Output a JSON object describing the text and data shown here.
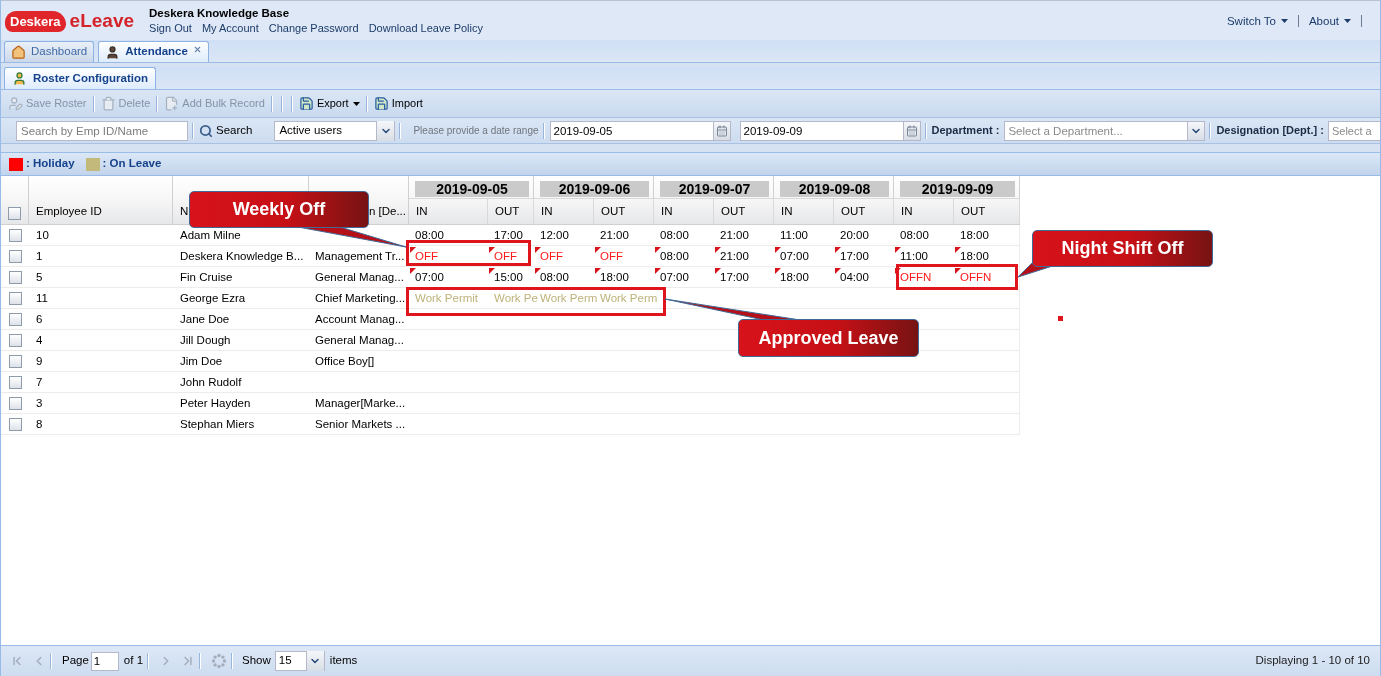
{
  "header": {
    "logo": {
      "brand": "Deskera",
      "product": "eLeave"
    },
    "title": "Deskera Knowledge Base",
    "links": [
      "Sign Out",
      "My Account",
      "Change Password",
      "Download Leave Policy"
    ],
    "menus": [
      "Switch To",
      "About"
    ]
  },
  "main_tabs": [
    {
      "label": "Dashboard",
      "selected": false,
      "closable": false
    },
    {
      "label": "Attendance",
      "selected": true,
      "closable": true
    }
  ],
  "sub_tabs": [
    {
      "label": "Roster Configuration",
      "selected": true
    }
  ],
  "toolbar": [
    {
      "label": "Save Roster",
      "disabled": true,
      "menu": false
    },
    {
      "label": "Delete",
      "disabled": true,
      "menu": false
    },
    {
      "label": "Add Bulk Record",
      "disabled": true,
      "menu": false
    },
    {
      "label": "Export",
      "disabled": false,
      "menu": true
    },
    {
      "label": "Import",
      "disabled": false,
      "menu": false
    }
  ],
  "filters": {
    "search": {
      "placeholder": "Search by Emp ID/Name"
    },
    "search_button": "Search",
    "status": {
      "value": "Active users"
    },
    "date_hint": "Please provide a date range",
    "date_from": {
      "value": "2019-09-05"
    },
    "date_to": {
      "value": "2019-09-09"
    },
    "department": {
      "label": "Department :",
      "placeholder": "Select a Department..."
    },
    "designation": {
      "label": "Designation [Dept.] :",
      "placeholder": "Select a"
    }
  },
  "legend": [
    {
      "label": ": Holiday",
      "color": "#ff0000"
    },
    {
      "label": ": On Leave",
      "color": "#c3b97a"
    }
  ],
  "grid": {
    "all_selected": false,
    "columns": [
      "Employee ID",
      "N",
      "n [De..."
    ],
    "dates": [
      {
        "date": "2019-09-05",
        "in": "IN",
        "out": "OUT"
      },
      {
        "date": "2019-09-06",
        "in": "IN",
        "out": "OUT"
      },
      {
        "date": "2019-09-07",
        "in": "IN",
        "out": "OUT"
      },
      {
        "date": "2019-09-08",
        "in": "IN",
        "out": "OUT"
      },
      {
        "date": "2019-09-09",
        "in": "IN",
        "out": "OUT"
      }
    ],
    "rows": [
      {
        "selected": false,
        "edited": false,
        "id": "10",
        "name": "Adam Milne",
        "shifts": [
          {
            "text": "08:00",
            "kind": "time"
          },
          {
            "text": "17:00",
            "kind": "time"
          },
          {
            "text": "12:00",
            "kind": "time"
          },
          {
            "text": "21:00",
            "kind": "time"
          },
          {
            "text": "08:00",
            "kind": "time"
          },
          {
            "text": "21:00",
            "kind": "time"
          },
          {
            "text": "11:00",
            "kind": "time"
          },
          {
            "text": "20:00",
            "kind": "time"
          },
          {
            "text": "08:00",
            "kind": "time"
          },
          {
            "text": "18:00",
            "kind": "time"
          }
        ]
      },
      {
        "selected": false,
        "edited": true,
        "id": "1",
        "name": "Deskera Knowledge B...",
        "designation": "Management Tr...",
        "shifts": [
          {
            "text": "OFF",
            "kind": "off"
          },
          {
            "text": "OFF",
            "kind": "off"
          },
          {
            "text": "OFF",
            "kind": "off"
          },
          {
            "text": "OFF",
            "kind": "off"
          },
          {
            "text": "08:00",
            "kind": "time"
          },
          {
            "text": "21:00",
            "kind": "time"
          },
          {
            "text": "07:00",
            "kind": "time"
          },
          {
            "text": "17:00",
            "kind": "time"
          },
          {
            "text": "11:00",
            "kind": "time"
          },
          {
            "text": "18:00",
            "kind": "time"
          }
        ]
      },
      {
        "selected": false,
        "edited": true,
        "id": "5",
        "name": "Fin Cruise",
        "designation": "General Manag...",
        "shifts": [
          {
            "text": "07:00",
            "kind": "time"
          },
          {
            "text": "15:00",
            "kind": "time"
          },
          {
            "text": "08:00",
            "kind": "time"
          },
          {
            "text": "18:00",
            "kind": "time"
          },
          {
            "text": "07:00",
            "kind": "time"
          },
          {
            "text": "17:00",
            "kind": "time"
          },
          {
            "text": "18:00",
            "kind": "time"
          },
          {
            "text": "04:00",
            "kind": "time"
          },
          {
            "text": "OFFN",
            "kind": "off"
          },
          {
            "text": "OFFN",
            "kind": "off"
          }
        ]
      },
      {
        "selected": false,
        "edited": false,
        "id": "11",
        "name": "George Ezra",
        "designation": "Chief Marketing...",
        "shifts": [
          {
            "text": "Work Permit",
            "kind": "leave"
          },
          {
            "text": "Work Pe",
            "kind": "leave"
          },
          {
            "text": "Work Perm",
            "kind": "leave"
          },
          {
            "text": "Work Perm",
            "kind": "leave"
          }
        ]
      },
      {
        "selected": false,
        "id": "6",
        "name": "Jane Doe",
        "designation": "Account Manag..."
      },
      {
        "selected": false,
        "id": "4",
        "name": "Jill Dough",
        "designation": "General Manag..."
      },
      {
        "selected": false,
        "id": "9",
        "name": "Jim Doe",
        "designation": "Office Boy[]"
      },
      {
        "selected": false,
        "id": "7",
        "name": "John Rudolf"
      },
      {
        "selected": false,
        "id": "3",
        "name": "Peter Hayden",
        "designation": "Manager[Marke..."
      },
      {
        "selected": false,
        "id": "8",
        "name": "Stephan Miers",
        "designation": "Senior Markets ..."
      }
    ]
  },
  "pagination": {
    "buttons": [
      {
        "kind": "first",
        "disabled": true
      },
      {
        "kind": "prev",
        "disabled": true
      },
      {
        "kind": "next",
        "disabled": true
      },
      {
        "kind": "last",
        "disabled": true
      },
      {
        "kind": "refresh",
        "disabled": true
      }
    ],
    "page_label": "Page",
    "page": "1",
    "page_count": "of 1",
    "show_label": "Show",
    "page_size": "15",
    "items_label": "items",
    "summary": "Displaying 1 - 10 of 10"
  },
  "annotations": [
    {
      "text": "Weekly Off"
    },
    {
      "text": "Night Shift Off"
    },
    {
      "text": "Approved Leave"
    }
  ]
}
